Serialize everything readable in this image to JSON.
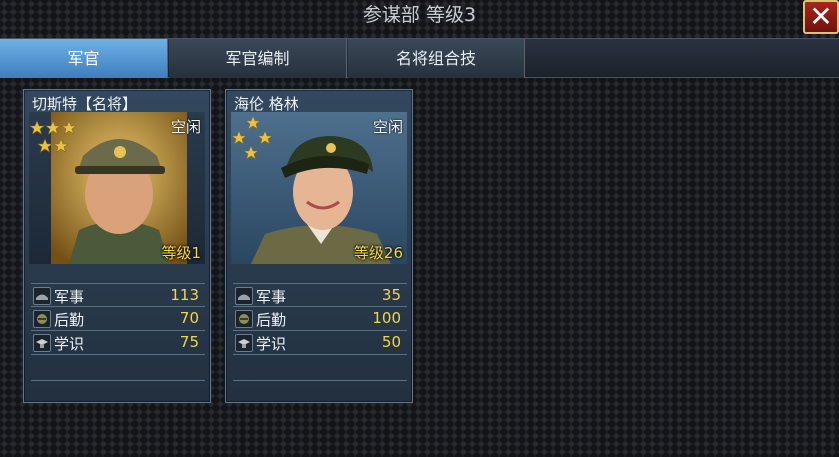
{
  "header": {
    "title": "参谋部 等级3",
    "close_icon": "close-icon"
  },
  "tabs": [
    {
      "label": "军官",
      "active": true
    },
    {
      "label": "军官编制",
      "active": false
    },
    {
      "label": "名将组合技",
      "active": false
    }
  ],
  "officers": [
    {
      "name": "切斯特【名将】",
      "status": "空闲",
      "level": "等级1",
      "stars": 5,
      "stats": [
        {
          "label": "军事",
          "value": "113",
          "icon": "military-icon"
        },
        {
          "label": "后勤",
          "value": "70",
          "icon": "logistics-icon"
        },
        {
          "label": "学识",
          "value": "75",
          "icon": "knowledge-icon"
        }
      ]
    },
    {
      "name": "海伦 格林",
      "status": "空闲",
      "level": "等级26",
      "stars": 4,
      "stats": [
        {
          "label": "军事",
          "value": "35",
          "icon": "military-icon"
        },
        {
          "label": "后勤",
          "value": "100",
          "icon": "logistics-icon"
        },
        {
          "label": "学识",
          "value": "50",
          "icon": "knowledge-icon"
        }
      ]
    }
  ],
  "colors": {
    "accent_tab": "#5a9ad6",
    "value_yellow": "#f4d64a",
    "close_red": "#a8261c"
  }
}
